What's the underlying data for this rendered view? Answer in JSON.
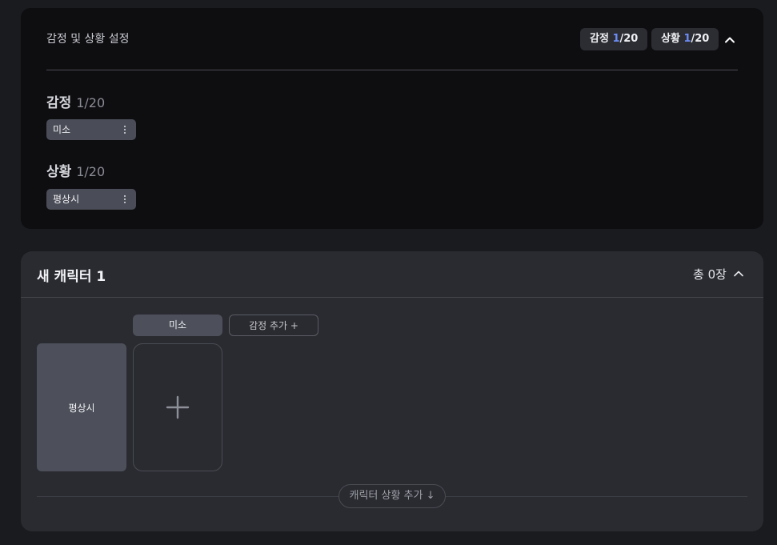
{
  "settings": {
    "title": "감정 및 상황 설정",
    "emotion_pill": {
      "label": "감정 ",
      "current": "1",
      "total": "/20"
    },
    "situation_pill": {
      "label": "상황 ",
      "current": "1",
      "total": "/20"
    },
    "collapse_icon": "chevron-up-icon",
    "emotion_section": {
      "title": "감정",
      "count": "1/20",
      "items": [
        {
          "label": "미소"
        }
      ]
    },
    "situation_section": {
      "title": "상황",
      "count": "1/20",
      "items": [
        {
          "label": "평상시"
        }
      ]
    }
  },
  "character": {
    "name": "새 캐릭터 1",
    "total": "총 0장",
    "columns": [
      {
        "label": "미소"
      }
    ],
    "add_emotion_label": "감정 추가 +",
    "rows": [
      {
        "label": "평상시"
      }
    ],
    "add_situation_label": "캐릭터 상황 추가 ↓"
  },
  "colors": {
    "background": "#1a1b1e",
    "panel_dark": "#0e0e11",
    "panel_char": "#2a2b31",
    "accent_blue": "#6d8df6",
    "tag_bg": "#4a4c57"
  }
}
